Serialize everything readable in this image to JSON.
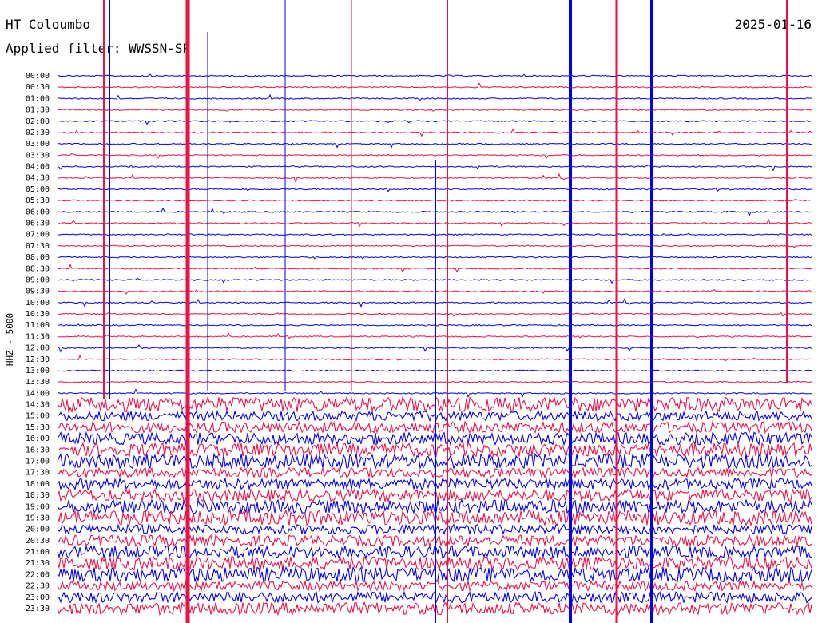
{
  "header": {
    "station": "HT Coloumbo",
    "date": "2025-01-16",
    "filter": "Applied filter: WWSSN-SP"
  },
  "chart_data": {
    "type": "line",
    "title": "HT Coloumbo",
    "ylabel": "HHZ - 5000",
    "categories": [
      "00:00",
      "00:30",
      "01:00",
      "01:30",
      "02:00",
      "02:30",
      "03:00",
      "03:30",
      "04:00",
      "04:30",
      "05:00",
      "05:30",
      "06:00",
      "06:30",
      "07:00",
      "07:30",
      "08:00",
      "08:30",
      "09:00",
      "09:30",
      "10:00",
      "10:30",
      "11:00",
      "11:30",
      "12:00",
      "12:30",
      "13:00",
      "13:30",
      "14:00",
      "14:30",
      "15:00",
      "15:30",
      "16:00",
      "16:30",
      "17:00",
      "17:30",
      "18:00",
      "18:30",
      "19:00",
      "19:30",
      "20:00",
      "20:30",
      "21:00",
      "21:30",
      "22:00",
      "22:30",
      "23:00",
      "23:30"
    ],
    "trace_colors": [
      "#0000ee",
      "#ee1144"
    ],
    "x_range_minutes": [
      0,
      30
    ],
    "grid": false,
    "legend": "none"
  }
}
